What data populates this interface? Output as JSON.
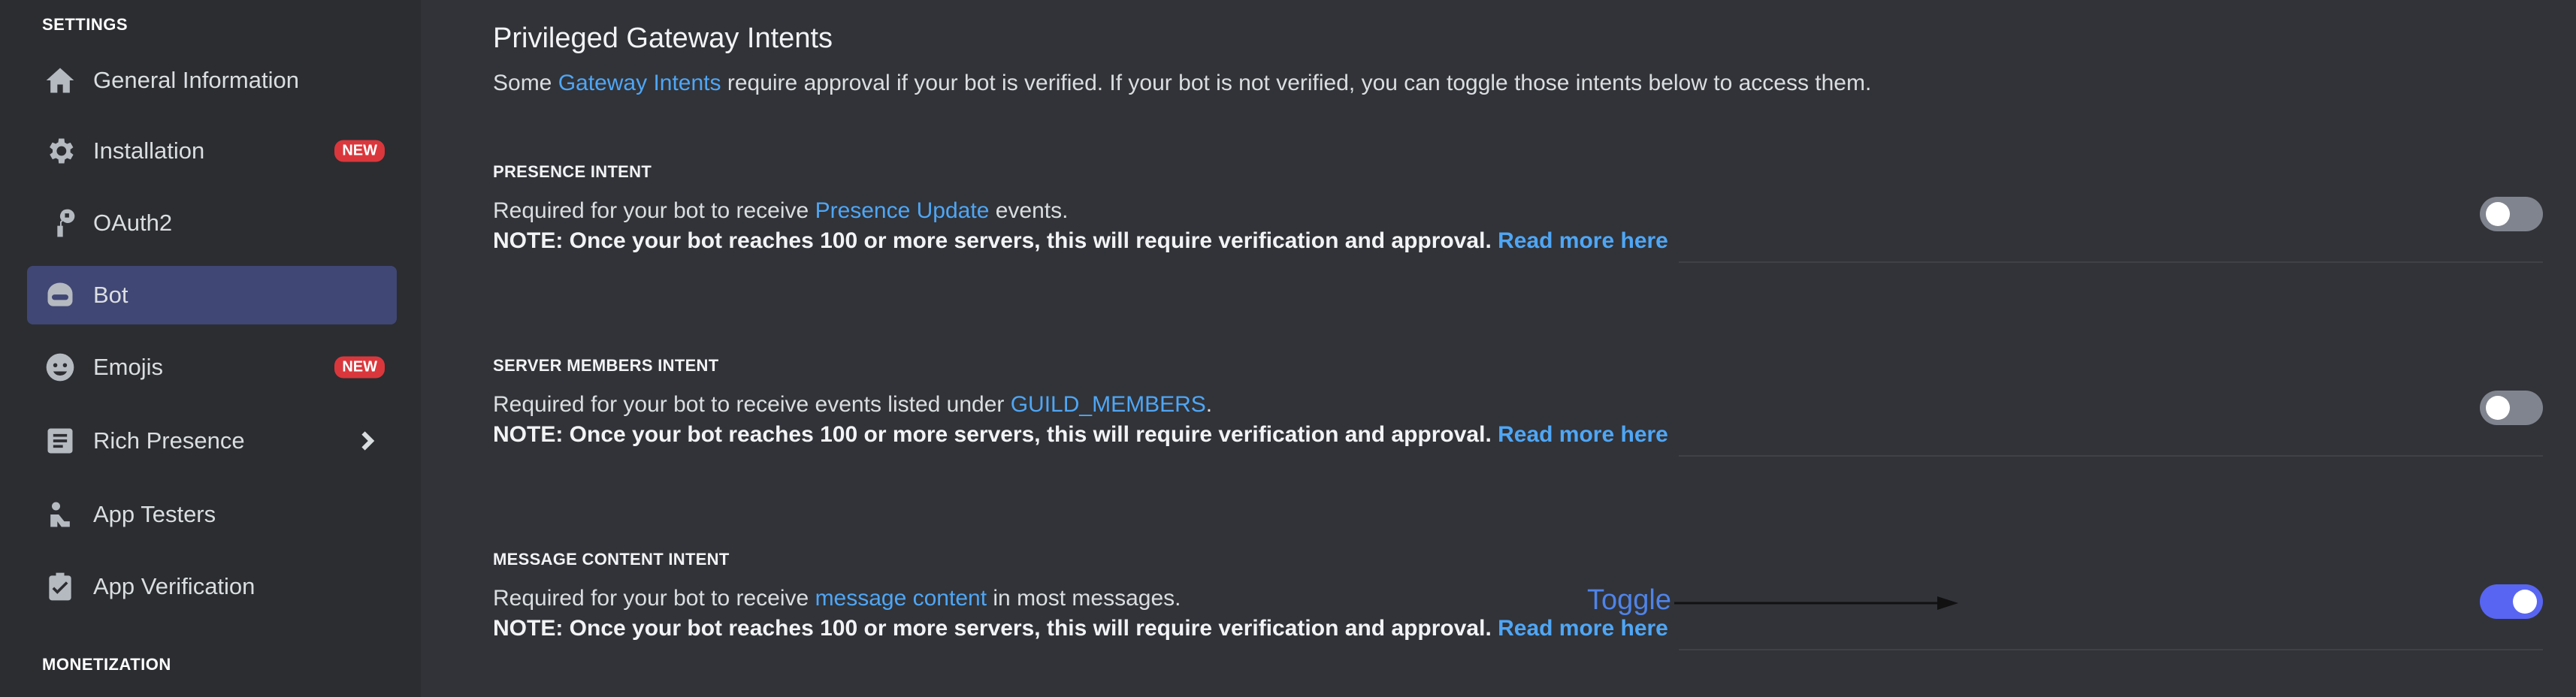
{
  "sidebar": {
    "settings_label": "SETTINGS",
    "monetization_label": "MONETIZATION",
    "items": [
      {
        "label": "General Information",
        "icon": "home-icon"
      },
      {
        "label": "Installation",
        "icon": "gear-icon",
        "badge": "NEW"
      },
      {
        "label": "OAuth2",
        "icon": "wrench-icon"
      },
      {
        "label": "Bot",
        "icon": "bot-icon",
        "active": true
      },
      {
        "label": "Emojis",
        "icon": "emoji-icon",
        "badge": "NEW"
      },
      {
        "label": "Rich Presence",
        "icon": "rich-presence-icon",
        "chevron": true
      },
      {
        "label": "App Testers",
        "icon": "app-testers-icon"
      },
      {
        "label": "App Verification",
        "icon": "clipboard-check-icon"
      }
    ]
  },
  "main": {
    "title": "Privileged Gateway Intents",
    "description": {
      "prefix": "Some ",
      "link": "Gateway Intents",
      "suffix": " require approval if your bot is verified. If your bot is not verified, you can toggle those intents below to access them."
    },
    "intents": [
      {
        "title": "PRESENCE INTENT",
        "line1_prefix": "Required for your bot to receive ",
        "line1_link": "Presence Update",
        "line1_suffix": " events.",
        "note": "NOTE: Once your bot reaches 100 or more servers, this will require verification and approval. ",
        "note_link": "Read more here",
        "enabled": false
      },
      {
        "title": "SERVER MEMBERS INTENT",
        "line1_prefix": "Required for your bot to receive events listed under ",
        "line1_link": "GUILD_MEMBERS",
        "line1_suffix": ".",
        "note": "NOTE: Once your bot reaches 100 or more servers, this will require verification and approval. ",
        "note_link": "Read more here",
        "enabled": false
      },
      {
        "title": "MESSAGE CONTENT INTENT",
        "line1_prefix": "Required for your bot to receive ",
        "line1_link": "message content",
        "line1_suffix": " in most messages.",
        "note": "NOTE: Once your bot reaches 100 or more servers, this will require verification and approval. ",
        "note_link": "Read more here",
        "enabled": true
      }
    ]
  },
  "annotation": {
    "label": "Toggle",
    "color": "#4f83e8"
  },
  "colors": {
    "accent": "#5865f2",
    "link": "#4fa6f5",
    "badge": "#da373c",
    "active_nav": "#404774"
  }
}
